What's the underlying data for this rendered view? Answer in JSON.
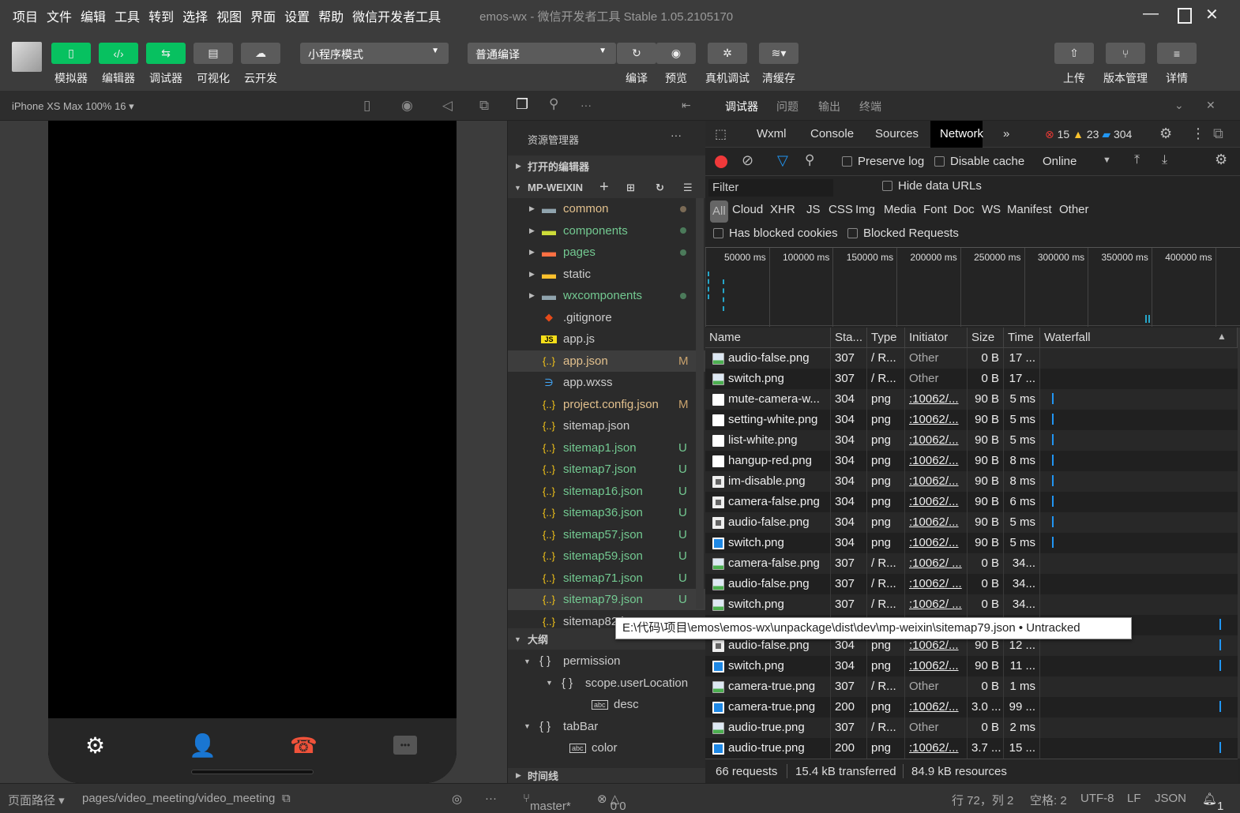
{
  "menu": [
    "项目",
    "文件",
    "编辑",
    "工具",
    "转到",
    "选择",
    "视图",
    "界面",
    "设置",
    "帮助",
    "微信开发者工具"
  ],
  "window_title": "emos-wx - 微信开发者工具 Stable 1.05.2105170",
  "toolbar": {
    "left_buttons": [
      {
        "label": "模拟器",
        "icon": "phone-icon"
      },
      {
        "label": "编辑器",
        "icon": "code-icon"
      },
      {
        "label": "调试器",
        "icon": "debug-icon"
      },
      {
        "label": "可视化",
        "icon": "layout-icon"
      },
      {
        "label": "云开发",
        "icon": "cloud-icon"
      }
    ],
    "mode_select": "小程序模式",
    "compile_select": "普通编译",
    "mid_buttons": [
      {
        "label": "编译",
        "icon": "refresh-icon"
      },
      {
        "label": "预览",
        "icon": "eye-icon"
      },
      {
        "label": "真机调试",
        "icon": "bug-icon"
      },
      {
        "label": "清缓存",
        "icon": "layers-icon"
      }
    ],
    "right_buttons": [
      {
        "label": "上传",
        "icon": "upload-icon"
      },
      {
        "label": "版本管理",
        "icon": "branch-icon"
      },
      {
        "label": "详情",
        "icon": "menu-icon"
      }
    ],
    "accent": "#07c160"
  },
  "simulator": {
    "device": "iPhone XS Max 100% 16 ▾",
    "tabbar_icons": [
      "gear-icon",
      "contact-list-icon",
      "hangup-icon",
      "chat-icon"
    ],
    "hangup_color": "#f0523a"
  },
  "panel_tabs": [
    "调试器",
    "问题",
    "输出",
    "终端"
  ],
  "explorer": {
    "title": "资源管理器",
    "open_editors": "打开的编辑器",
    "root": "MP-WEIXIN",
    "items": [
      {
        "name": "common",
        "kind": "folder",
        "color": "#e2c08d",
        "dot": "#7a6a55"
      },
      {
        "name": "components",
        "kind": "folder-components",
        "color": "#73c991",
        "dot": "#4b7a5a"
      },
      {
        "name": "pages",
        "kind": "folder-pages",
        "color": "#73c991",
        "dot": "#4b7a5a"
      },
      {
        "name": "static",
        "kind": "folder-static",
        "color": "#cccccc"
      },
      {
        "name": "wxcomponents",
        "kind": "folder",
        "color": "#73c991",
        "dot": "#4b7a5a"
      },
      {
        "name": ".gitignore",
        "kind": "git",
        "color": "#cccccc"
      },
      {
        "name": "app.js",
        "kind": "js",
        "color": "#cccccc"
      },
      {
        "name": "app.json",
        "kind": "json",
        "color": "#e2c08d",
        "badge": "M"
      },
      {
        "name": "app.wxss",
        "kind": "css",
        "color": "#cccccc"
      },
      {
        "name": "project.config.json",
        "kind": "json",
        "color": "#e2c08d",
        "badge": "M"
      },
      {
        "name": "sitemap.json",
        "kind": "json",
        "color": "#cccccc"
      },
      {
        "name": "sitemap1.json",
        "kind": "json",
        "color": "#73c991",
        "badge": "U"
      },
      {
        "name": "sitemap7.json",
        "kind": "json",
        "color": "#73c991",
        "badge": "U"
      },
      {
        "name": "sitemap16.json",
        "kind": "json",
        "color": "#73c991",
        "badge": "U"
      },
      {
        "name": "sitemap36.json",
        "kind": "json",
        "color": "#73c991",
        "badge": "U"
      },
      {
        "name": "sitemap57.json",
        "kind": "json",
        "color": "#73c991",
        "badge": "U"
      },
      {
        "name": "sitemap59.json",
        "kind": "json",
        "color": "#73c991",
        "badge": "U"
      },
      {
        "name": "sitemap71.json",
        "kind": "json",
        "color": "#73c991",
        "badge": "U"
      },
      {
        "name": "sitemap79.json",
        "kind": "json",
        "color": "#73c991",
        "badge": "U",
        "selected": true
      },
      {
        "name": "sitemap82.j",
        "kind": "json",
        "color": "#cccccc"
      }
    ],
    "outline_title": "大纲",
    "outline": [
      {
        "name": "permission",
        "kind": "object",
        "depth": 0
      },
      {
        "name": "scope.userLocation",
        "kind": "object",
        "depth": 1
      },
      {
        "name": "desc",
        "kind": "string",
        "depth": 2
      },
      {
        "name": "tabBar",
        "kind": "object",
        "depth": 0
      },
      {
        "name": "color",
        "kind": "string",
        "depth": 1
      }
    ],
    "timeline_title": "时间线"
  },
  "devtools": {
    "tabs": [
      "Wxml",
      "Console",
      "Sources",
      "Network"
    ],
    "active_tab": "Network",
    "errors": "15",
    "warnings": "23",
    "infos": "304",
    "preserve_log": "Preserve log",
    "preserve_log_checked": false,
    "disable_cache": "Disable cache",
    "disable_cache_checked": false,
    "throttle": "Online",
    "filter_placeholder": "Filter",
    "hide_data_urls": "Hide data URLs",
    "types": [
      "All",
      "Cloud",
      "XHR",
      "JS",
      "CSS",
      "Img",
      "Media",
      "Font",
      "Doc",
      "WS",
      "Manifest",
      "Other"
    ],
    "active_type": "All",
    "has_blocked_cookies": "Has blocked cookies",
    "blocked_requests": "Blocked Requests",
    "timeline_ticks": [
      "50000 ms",
      "100000 ms",
      "150000 ms",
      "200000 ms",
      "250000 ms",
      "300000 ms",
      "350000 ms",
      "400000 ms",
      "4"
    ],
    "columns": [
      "Name",
      "Sta...",
      "Type",
      "Initiator",
      "Size",
      "Time",
      "Waterfall"
    ],
    "rows": [
      {
        "name": "audio-false.png",
        "status": "307",
        "type": "/ R...",
        "initiator": "Other",
        "size": "0 B",
        "time": "17 ...",
        "icon": "redirect"
      },
      {
        "name": "switch.png",
        "status": "307",
        "type": "/ R...",
        "initiator": "Other",
        "size": "0 B",
        "time": "17 ...",
        "icon": "redirect"
      },
      {
        "name": "mute-camera-w...",
        "status": "304",
        "type": "png",
        "initiator": ":10062/...",
        "size": "90 B",
        "time": "5 ms",
        "icon": "white",
        "wf": "early"
      },
      {
        "name": "setting-white.png",
        "status": "304",
        "type": "png",
        "initiator": ":10062/...",
        "size": "90 B",
        "time": "5 ms",
        "icon": "white",
        "wf": "early"
      },
      {
        "name": "list-white.png",
        "status": "304",
        "type": "png",
        "initiator": ":10062/...",
        "size": "90 B",
        "time": "5 ms",
        "icon": "white",
        "wf": "early"
      },
      {
        "name": "hangup-red.png",
        "status": "304",
        "type": "png",
        "initiator": ":10062/...",
        "size": "90 B",
        "time": "8 ms",
        "icon": "hangup",
        "wf": "early"
      },
      {
        "name": "im-disable.png",
        "status": "304",
        "type": "png",
        "initiator": ":10062/...",
        "size": "90 B",
        "time": "8 ms",
        "icon": "grey",
        "wf": "early"
      },
      {
        "name": "camera-false.png",
        "status": "304",
        "type": "png",
        "initiator": ":10062/...",
        "size": "90 B",
        "time": "6 ms",
        "icon": "grey",
        "wf": "early"
      },
      {
        "name": "audio-false.png",
        "status": "304",
        "type": "png",
        "initiator": ":10062/...",
        "size": "90 B",
        "time": "5 ms",
        "icon": "grey",
        "wf": "early"
      },
      {
        "name": "switch.png",
        "status": "304",
        "type": "png",
        "initiator": ":10062/...",
        "size": "90 B",
        "time": "5 ms",
        "icon": "blue",
        "wf": "early"
      },
      {
        "name": "camera-false.png",
        "status": "307",
        "type": "/ R...",
        "initiator": ":10062/ ...",
        "size": "0 B",
        "time": "34...",
        "icon": "redirect"
      },
      {
        "name": "audio-false.png",
        "status": "307",
        "type": "/ R...",
        "initiator": ":10062/ ...",
        "size": "0 B",
        "time": "34...",
        "icon": "redirect"
      },
      {
        "name": "switch.png",
        "status": "307",
        "type": "/ R...",
        "initiator": ":10062/ ...",
        "size": "0 B",
        "time": "34...",
        "icon": "redirect"
      },
      {
        "name": "",
        "status": "",
        "type": "",
        "initiator": "",
        "size": "",
        "time": "",
        "icon": "none",
        "wf": "late"
      },
      {
        "name": "audio-false.png",
        "status": "304",
        "type": "png",
        "initiator": ":10062/...",
        "size": "90 B",
        "time": "12 ...",
        "icon": "grey",
        "wf": "late"
      },
      {
        "name": "switch.png",
        "status": "304",
        "type": "png",
        "initiator": ":10062/...",
        "size": "90 B",
        "time": "11 ...",
        "icon": "blue",
        "wf": "late"
      },
      {
        "name": "camera-true.png",
        "status": "307",
        "type": "/ R...",
        "initiator": "Other",
        "size": "0 B",
        "time": "1 ms",
        "icon": "redirect"
      },
      {
        "name": "camera-true.png",
        "status": "200",
        "type": "png",
        "initiator": ":10062/...",
        "size": "3.0 ...",
        "time": "99 ...",
        "icon": "blue",
        "wf": "late"
      },
      {
        "name": "audio-true.png",
        "status": "307",
        "type": "/ R...",
        "initiator": "Other",
        "size": "0 B",
        "time": "2 ms",
        "icon": "redirect"
      },
      {
        "name": "audio-true.png",
        "status": "200",
        "type": "png",
        "initiator": ":10062/...",
        "size": "3.7 ...",
        "time": "15 ...",
        "icon": "blue",
        "wf": "late"
      }
    ],
    "footer": {
      "requests": "66 requests",
      "transferred": "15.4 kB transferred",
      "resources": "84.9 kB resources"
    }
  },
  "tooltip": "E:\\代码\\项目\\emos\\emos-wx\\unpackage\\dist\\dev\\mp-weixin\\sitemap79.json • Untracked",
  "statusbar": {
    "page_path_label": "页面路径 ▾",
    "page_path": "pages/video_meeting/video_meeting",
    "branch": "master*",
    "errors": "0",
    "warnings": "0",
    "cursor": "行 72，列 2",
    "indent": "空格: 2",
    "encoding": "UTF-8",
    "eol": "LF",
    "language": "JSON",
    "notifications": "1"
  }
}
